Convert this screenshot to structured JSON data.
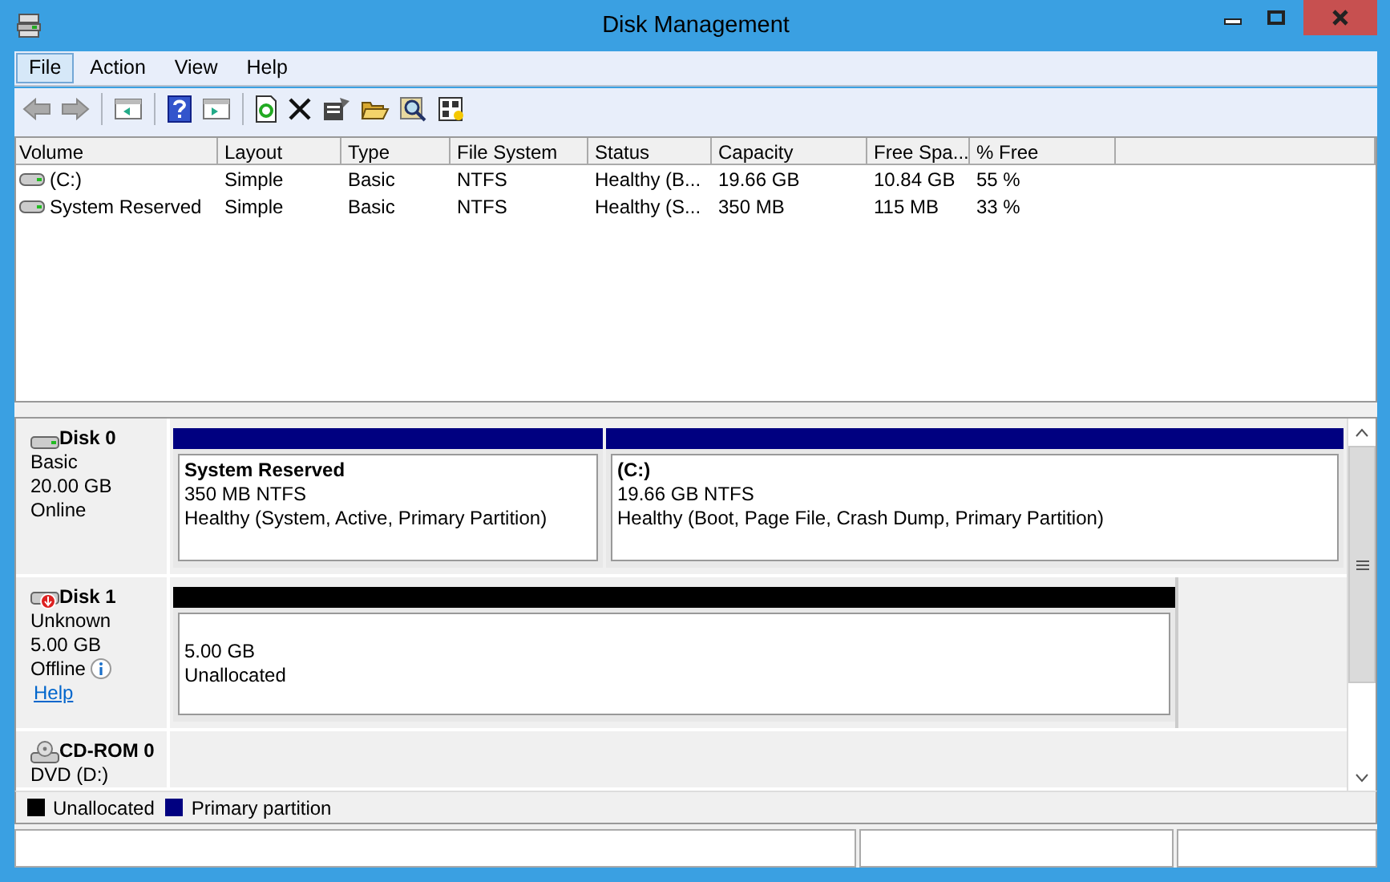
{
  "window": {
    "title": "Disk Management"
  },
  "menu": [
    {
      "label": "File",
      "selected": true
    },
    {
      "label": "Action",
      "selected": false
    },
    {
      "label": "View",
      "selected": false
    },
    {
      "label": "Help",
      "selected": false
    }
  ],
  "volume_list": {
    "columns": [
      "Volume",
      "Layout",
      "Type",
      "File System",
      "Status",
      "Capacity",
      "Free Spa...",
      "% Free"
    ],
    "rows": [
      [
        "(C:)",
        "Simple",
        "Basic",
        "NTFS",
        "Healthy (B...",
        "19.66 GB",
        "10.84 GB",
        "55 %"
      ],
      [
        "System Reserved",
        "Simple",
        "Basic",
        "NTFS",
        "Healthy (S...",
        "350 MB",
        "115 MB",
        "33 %"
      ]
    ]
  },
  "disks": [
    {
      "kind": "basic",
      "name": "Disk 0",
      "lines": [
        "Basic",
        "20.00 GB",
        "Online"
      ],
      "partitions": [
        {
          "name": "System Reserved",
          "size": "350 MB NTFS",
          "status": "Healthy (System, Active, Primary Partition)",
          "color": "#000080"
        },
        {
          "name": "(C:)",
          "size": "19.66 GB NTFS",
          "status": "Healthy (Boot, Page File, Crash Dump, Primary Partition)",
          "color": "#000080"
        }
      ]
    },
    {
      "kind": "offline",
      "name": "Disk 1",
      "lines": [
        "Unknown",
        "5.00 GB",
        "Offline"
      ],
      "info": true,
      "link": "Help",
      "partitions": [
        {
          "size": "5.00 GB",
          "status": "Unallocated",
          "color": "#000000"
        }
      ]
    },
    {
      "kind": "cdrom",
      "name": "CD-ROM 0",
      "lines": [
        "DVD (D:)"
      ]
    }
  ],
  "legend": [
    {
      "label": "Unallocated",
      "color": "#000000"
    },
    {
      "label": "Primary partition",
      "color": "#000080"
    }
  ]
}
